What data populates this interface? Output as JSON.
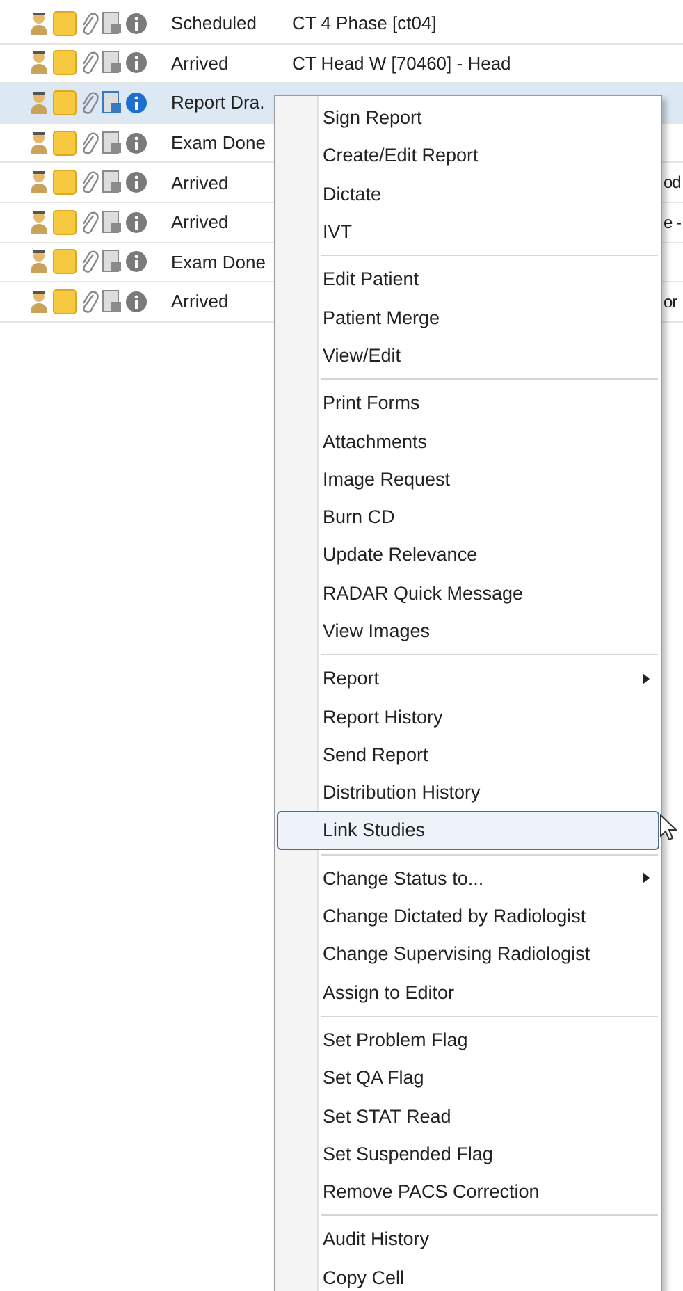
{
  "rows": [
    {
      "status": "Scheduled",
      "procedure": "CT 4 Phase [ct04]",
      "selected": false
    },
    {
      "status": "Arrived",
      "procedure": "CT Head W [70460] - Head",
      "selected": false
    },
    {
      "status": "Report Dra.",
      "selected": true
    },
    {
      "status": "Exam Done",
      "selected": false
    },
    {
      "status": "Arrived",
      "procedure_fragment": "od",
      "selected": false
    },
    {
      "status": "Arrived",
      "procedure_fragment": "e -",
      "selected": false
    },
    {
      "status": "Exam Done",
      "selected": false
    },
    {
      "status": "Arrived",
      "procedure_fragment": "or",
      "selected": false
    }
  ],
  "context_menu": {
    "groups": [
      [
        {
          "label": "Sign Report",
          "submenu": false,
          "highlighted": false
        },
        {
          "label": "Create/Edit Report",
          "submenu": false,
          "highlighted": false
        },
        {
          "label": "Dictate",
          "submenu": false,
          "highlighted": false
        },
        {
          "label": "IVT",
          "submenu": false,
          "highlighted": false
        }
      ],
      [
        {
          "label": "Edit Patient",
          "submenu": false,
          "highlighted": false
        },
        {
          "label": "Patient Merge",
          "submenu": false,
          "highlighted": false
        },
        {
          "label": "View/Edit",
          "submenu": false,
          "highlighted": false
        }
      ],
      [
        {
          "label": "Print Forms",
          "submenu": false,
          "highlighted": false
        },
        {
          "label": "Attachments",
          "submenu": false,
          "highlighted": false
        },
        {
          "label": "Image Request",
          "submenu": false,
          "highlighted": false
        },
        {
          "label": "Burn CD",
          "submenu": false,
          "highlighted": false
        },
        {
          "label": "Update Relevance",
          "submenu": false,
          "highlighted": false
        },
        {
          "label": "RADAR Quick Message",
          "submenu": false,
          "highlighted": false
        },
        {
          "label": "View Images",
          "submenu": false,
          "highlighted": false
        }
      ],
      [
        {
          "label": "Report",
          "submenu": true,
          "highlighted": false
        },
        {
          "label": "Report History",
          "submenu": false,
          "highlighted": false
        },
        {
          "label": "Send Report",
          "submenu": false,
          "highlighted": false
        },
        {
          "label": "Distribution History",
          "submenu": false,
          "highlighted": false
        },
        {
          "label": "Link Studies",
          "submenu": false,
          "highlighted": true
        }
      ],
      [
        {
          "label": "Change Status to...",
          "submenu": true,
          "highlighted": false
        },
        {
          "label": "Change Dictated by Radiologist",
          "submenu": false,
          "highlighted": false
        },
        {
          "label": "Change Supervising Radiologist",
          "submenu": false,
          "highlighted": false
        },
        {
          "label": "Assign to Editor",
          "submenu": false,
          "highlighted": false
        }
      ],
      [
        {
          "label": "Set Problem Flag",
          "submenu": false,
          "highlighted": false
        },
        {
          "label": "Set QA Flag",
          "submenu": false,
          "highlighted": false
        },
        {
          "label": "Set STAT Read",
          "submenu": false,
          "highlighted": false
        },
        {
          "label": "Set Suspended Flag",
          "submenu": false,
          "highlighted": false
        },
        {
          "label": "Remove PACS Correction",
          "submenu": false,
          "highlighted": false
        }
      ],
      [
        {
          "label": "Audit History",
          "submenu": false,
          "highlighted": false
        },
        {
          "label": "Copy Cell",
          "submenu": false,
          "highlighted": false
        }
      ]
    ]
  }
}
